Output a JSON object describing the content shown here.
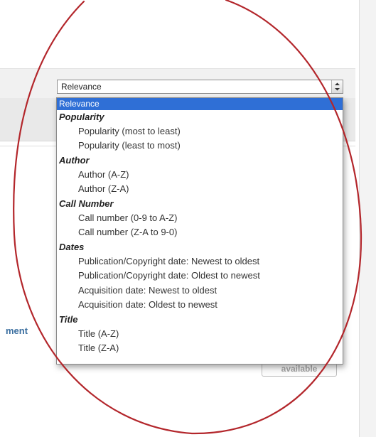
{
  "background": {
    "link_text": "ment",
    "button_label": "available"
  },
  "sort_select": {
    "value": "Relevance",
    "options": [
      {
        "kind": "selected",
        "label": "Relevance"
      },
      {
        "kind": "group",
        "label": "Popularity"
      },
      {
        "kind": "item",
        "label": "Popularity (most to least)"
      },
      {
        "kind": "item",
        "label": "Popularity (least to most)"
      },
      {
        "kind": "group",
        "label": "Author"
      },
      {
        "kind": "item",
        "label": "Author (A-Z)"
      },
      {
        "kind": "item",
        "label": "Author (Z-A)"
      },
      {
        "kind": "group",
        "label": "Call Number"
      },
      {
        "kind": "item",
        "label": "Call number (0-9 to A-Z)"
      },
      {
        "kind": "item",
        "label": "Call number (Z-A to 9-0)"
      },
      {
        "kind": "group",
        "label": "Dates"
      },
      {
        "kind": "item",
        "label": "Publication/Copyright date: Newest to oldest"
      },
      {
        "kind": "item",
        "label": "Publication/Copyright date: Oldest to newest"
      },
      {
        "kind": "item",
        "label": "Acquisition date: Newest to oldest"
      },
      {
        "kind": "item",
        "label": "Acquisition date: Oldest to newest"
      },
      {
        "kind": "group",
        "label": "Title"
      },
      {
        "kind": "item",
        "label": "Title (A-Z)"
      },
      {
        "kind": "item",
        "label": "Title (Z-A)"
      }
    ]
  },
  "colors": {
    "highlight": "#2f6fd6",
    "annotation": "#b3262b"
  }
}
